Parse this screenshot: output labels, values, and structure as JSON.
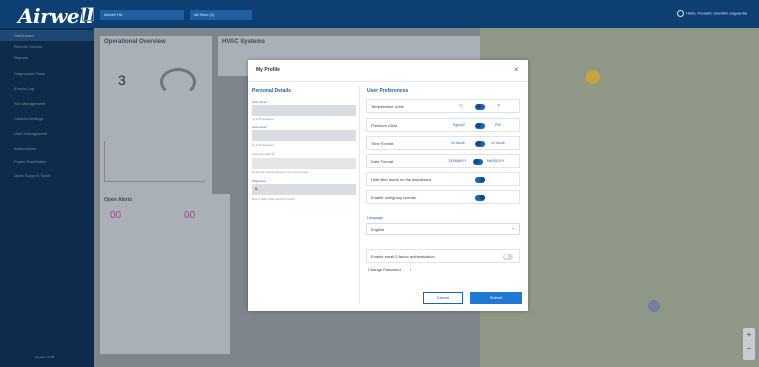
{
  "header": {
    "logo": "Airwell",
    "select1": "Airwell HA",
    "select2": "All Sites (2)",
    "user": "Hello, Frederic Glambin Jaguardia"
  },
  "sidebar": {
    "items": [
      {
        "label": "Dashboard",
        "active": true
      },
      {
        "label": "Remote Control"
      },
      {
        "label": "Reports"
      },
      {
        "label": "Diagnostics Tools"
      },
      {
        "label": "Events Log"
      },
      {
        "label": "Site Management"
      },
      {
        "label": "Custom Settings"
      },
      {
        "label": "User Management"
      },
      {
        "label": "Automations"
      },
      {
        "label": "Power Distribution"
      },
      {
        "label": "Open Support Ticket"
      }
    ],
    "footer": "Version 1.0.45"
  },
  "dashboard": {
    "operational_overview": "Operational Overview",
    "hvac_systems": "HVAC Systems",
    "open_alerts": "Open Alerts"
  },
  "modal": {
    "title": "My Profile",
    "close": "×",
    "personal": {
      "heading": "Personal Details",
      "first_name_label": "First name*",
      "first_name_hint": "Up to 30 characters",
      "last_name_label": "Last name*",
      "last_name_hint": "Up to 30 characters",
      "username_label": "Username/Email",
      "username_hint": "Email is the default username. Cannot be changed",
      "telephone_label": "Telephone",
      "telephone_flag": "IL",
      "telephone_hint": "Enter a valid mobile telephone number"
    },
    "prefs": {
      "heading": "User Preferences",
      "temperature": {
        "label": "Temperature Units",
        "opt1": "°C",
        "opt2": "°F"
      },
      "pressure": {
        "label": "Pressure Units",
        "opt1": "Kg/cm2",
        "opt2": "PSI"
      },
      "time": {
        "label": "Time Format",
        "opt1": "24 hours",
        "opt2": "12 hours"
      },
      "date": {
        "label": "Date Format",
        "opt1": "DD/MM/YY",
        "opt2": "MM/DD/YY"
      },
      "hide_filter": {
        "label": "Hide filter alerts on the dashboard"
      },
      "enable_unit": {
        "label": "Enable unit/group reorder"
      },
      "language_label": "Language",
      "language_value": "English",
      "two_factor": "Enable email 2-factor authentication",
      "change_password": "Change Password",
      "change_password_arrow": "›"
    },
    "cancel": "Cancel",
    "submit": "Submit"
  }
}
